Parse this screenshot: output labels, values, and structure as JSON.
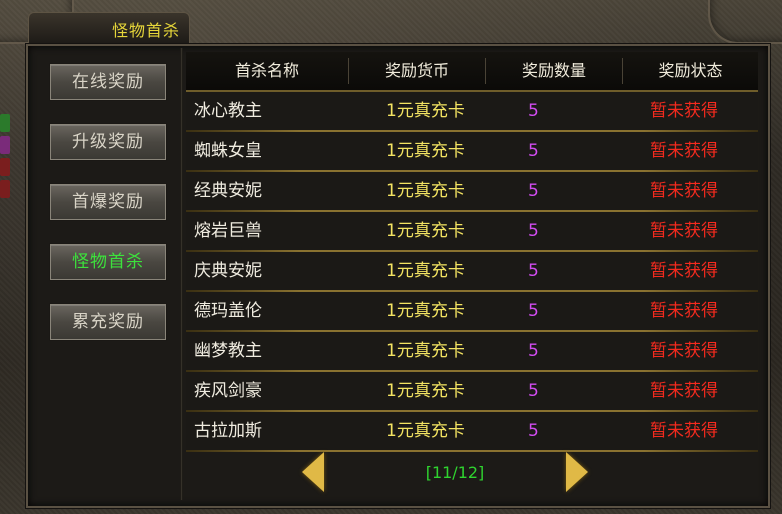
{
  "window": {
    "title": "怪物首杀"
  },
  "sidebar": {
    "items": [
      {
        "label": "在线奖励",
        "active": false
      },
      {
        "label": "升级奖励",
        "active": false
      },
      {
        "label": "首爆奖励",
        "active": false
      },
      {
        "label": "怪物首杀",
        "active": true
      },
      {
        "label": "累充奖励",
        "active": false
      }
    ]
  },
  "table": {
    "headers": [
      "首杀名称",
      "奖励货币",
      "奖励数量",
      "奖励状态"
    ],
    "rows": [
      {
        "name": "冰心教主",
        "currency": "1元真充卡",
        "qty": "5",
        "status": "暂未获得"
      },
      {
        "name": "蜘蛛女皇",
        "currency": "1元真充卡",
        "qty": "5",
        "status": "暂未获得"
      },
      {
        "name": "经典安妮",
        "currency": "1元真充卡",
        "qty": "5",
        "status": "暂未获得"
      },
      {
        "name": "熔岩巨兽",
        "currency": "1元真充卡",
        "qty": "5",
        "status": "暂未获得"
      },
      {
        "name": "庆典安妮",
        "currency": "1元真充卡",
        "qty": "5",
        "status": "暂未获得"
      },
      {
        "name": "德玛盖伦",
        "currency": "1元真充卡",
        "qty": "5",
        "status": "暂未获得"
      },
      {
        "name": "幽梦教主",
        "currency": "1元真充卡",
        "qty": "5",
        "status": "暂未获得"
      },
      {
        "name": "疾风剑豪",
        "currency": "1元真充卡",
        "qty": "5",
        "status": "暂未获得"
      },
      {
        "name": "古拉加斯",
        "currency": "1元真充卡",
        "qty": "5",
        "status": "暂未获得"
      }
    ]
  },
  "pagination": {
    "indicator": "[11/12]"
  },
  "colors": {
    "title": "#e6d63a",
    "active_tab": "#3ce23c",
    "currency": "#f4e462",
    "quantity": "#d24cf0",
    "status": "#f32a1e",
    "page_indicator": "#2fd32f",
    "arrow": "#e0b946"
  },
  "icons": {
    "prev": "chevron-left-icon",
    "next": "chevron-right-icon"
  }
}
